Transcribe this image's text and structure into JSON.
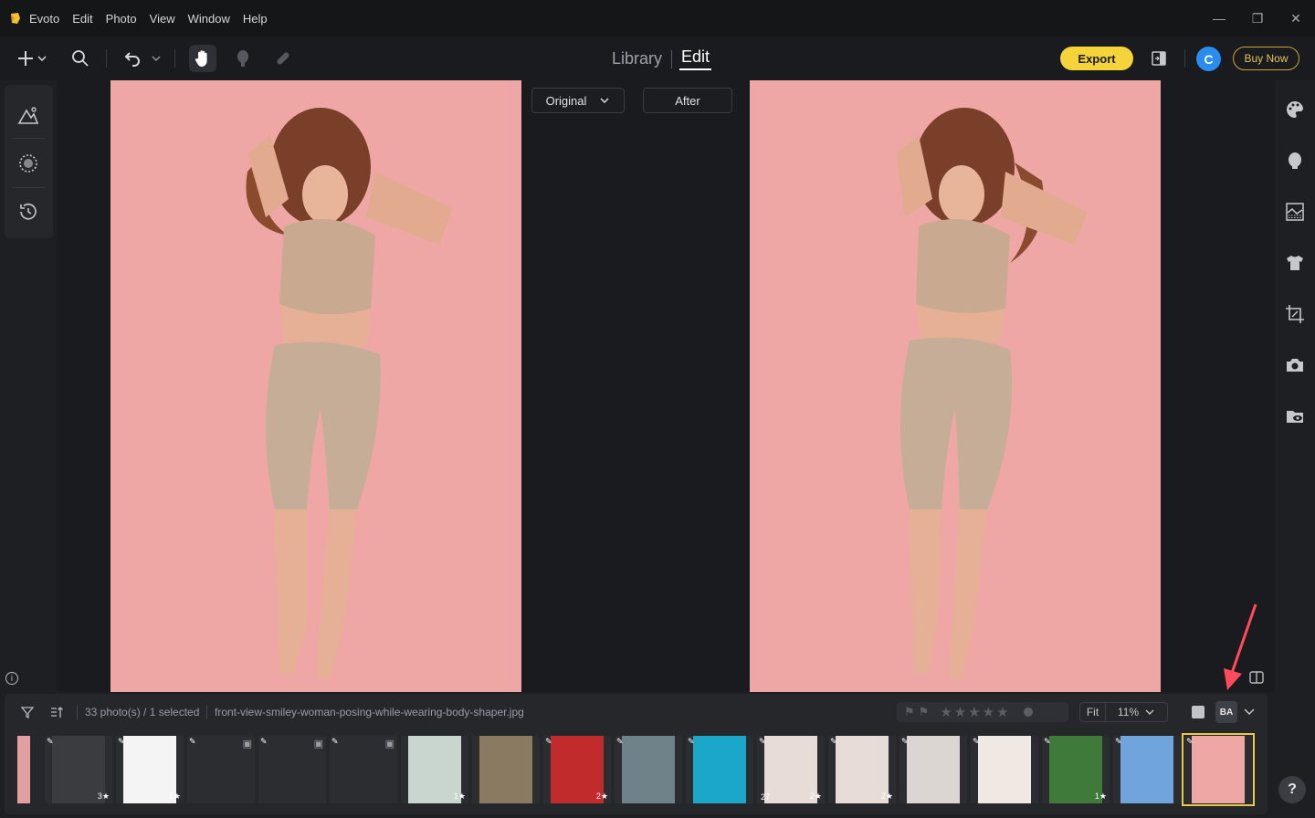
{
  "app": {
    "name": "Evoto",
    "menu": [
      "Edit",
      "Photo",
      "View",
      "Window",
      "Help"
    ],
    "window_controls": {
      "minimize": "—",
      "maximize": "❐",
      "close": "✕"
    }
  },
  "toolbar": {
    "mode_tabs": [
      {
        "label": "Library",
        "active": false
      },
      {
        "label": "Edit",
        "active": true
      }
    ],
    "export_label": "Export",
    "avatar_letter": "C",
    "buy_label": "Buy Now",
    "icons": [
      "add-icon",
      "chevron-down-icon",
      "search-icon",
      "undo-icon",
      "chevron-down-icon",
      "hand-icon",
      "mask-brush-icon",
      "bandage-icon",
      "compare-panel-icon"
    ]
  },
  "left_panel": {
    "icons": [
      "mountain-adjust-icon",
      "ai-select-icon",
      "history-icon"
    ]
  },
  "right_panel": {
    "icons": [
      "palette-icon",
      "face-icon",
      "background-icon",
      "shirt-icon",
      "crop-icon",
      "camera-icon",
      "folder-eye-icon"
    ]
  },
  "compare": {
    "before_label": "Original",
    "after_label": "After"
  },
  "filmstrip": {
    "count_text": "33 photo(s) / 1 selected",
    "filename": "front-view-smiley-woman-posing-while-wearing-body-shaper.jpg",
    "zoom_fit": "Fit",
    "zoom_value": "11%",
    "ba_label": "BA",
    "thumbnails": [
      {
        "edited": false,
        "rating": "",
        "tone": "#e39ea0"
      },
      {
        "edited": true,
        "rating": "3★",
        "tone": "#3b3c40"
      },
      {
        "edited": true,
        "rating": "1★",
        "tone": "#f4f4f4"
      },
      {
        "edited": true,
        "rating": "",
        "tone": "#2b2d31",
        "placeholder": true
      },
      {
        "edited": true,
        "rating": "",
        "tone": "#2b2d31",
        "placeholder": true
      },
      {
        "edited": true,
        "rating": "",
        "tone": "#2b2d31",
        "placeholder": true
      },
      {
        "edited": false,
        "rating": "1★",
        "tone": "#c9d6d0"
      },
      {
        "edited": false,
        "rating": "",
        "tone": "#8b7a62"
      },
      {
        "edited": true,
        "rating": "2★",
        "tone": "#c22b2b"
      },
      {
        "edited": true,
        "rating": "",
        "tone": "#6f8289"
      },
      {
        "edited": true,
        "rating": "",
        "tone": "#1aa7c9"
      },
      {
        "edited": true,
        "rating": "2★",
        "tone": "#e8dcd6",
        "count": "27"
      },
      {
        "edited": true,
        "rating": "2★",
        "tone": "#e7dcd6"
      },
      {
        "edited": true,
        "rating": "",
        "tone": "#dcd6d2"
      },
      {
        "edited": true,
        "rating": "",
        "tone": "#f0e8e2"
      },
      {
        "edited": true,
        "rating": "1★",
        "tone": "#3f7a3a"
      },
      {
        "edited": true,
        "rating": "",
        "tone": "#6fa4dc"
      },
      {
        "edited": true,
        "rating": "",
        "tone": "#eea7a5",
        "selected": true
      }
    ]
  },
  "colors": {
    "accent_yellow": "#f5d33b",
    "photo_bg": "#eea7a5",
    "avatar_blue": "#2b8cf0"
  }
}
